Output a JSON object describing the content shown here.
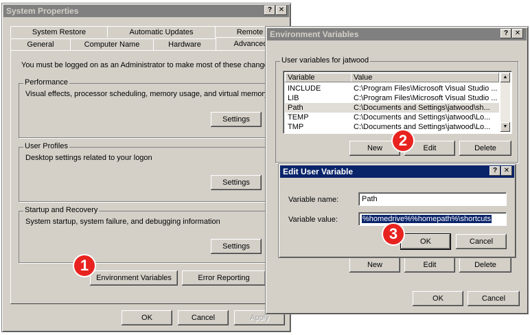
{
  "system_properties": {
    "title": "System Properties",
    "tabs_row1": [
      "System Restore",
      "Automatic Updates",
      "Remote"
    ],
    "tabs_row2": [
      "General",
      "Computer Name",
      "Hardware",
      "Advanced"
    ],
    "admin_notice": "You must be logged on as an Administrator to make most of these changes.",
    "performance": {
      "label": "Performance",
      "desc": "Visual effects, processor scheduling, memory usage, and virtual memory",
      "button": "Settings"
    },
    "user_profiles": {
      "label": "User Profiles",
      "desc": "Desktop settings related to your logon",
      "button": "Settings"
    },
    "startup_recovery": {
      "label": "Startup and Recovery",
      "desc": "System startup, system failure, and debugging information",
      "button": "Settings"
    },
    "env_vars_button": "Environment Variables",
    "error_reporting_button": "Error Reporting",
    "ok": "OK",
    "cancel": "Cancel",
    "apply": "Apply"
  },
  "env_vars": {
    "title": "Environment Variables",
    "user_group_label": "User variables for jatwood",
    "columns": [
      "Variable",
      "Value"
    ],
    "rows": [
      {
        "variable": "INCLUDE",
        "value": "C:\\Program Files\\Microsoft Visual Studio ..."
      },
      {
        "variable": "LIB",
        "value": "C:\\Program Files\\Microsoft Visual Studio ..."
      },
      {
        "variable": "Path",
        "value": "C:\\Documents and Settings\\jatwood\\sh..."
      },
      {
        "variable": "TEMP",
        "value": "C:\\Documents and Settings\\jatwood\\Lo..."
      },
      {
        "variable": "TMP",
        "value": "C:\\Documents and Settings\\jatwood\\Lo..."
      }
    ],
    "new": "New",
    "edit": "Edit",
    "delete": "Delete",
    "ok": "OK",
    "cancel": "Cancel"
  },
  "edit_var": {
    "title": "Edit User Variable",
    "name_label": "Variable name:",
    "name_value": "Path",
    "value_label": "Variable value:",
    "value_value": "%homedrive%%homepath%\\shortcuts",
    "ok": "OK",
    "cancel": "Cancel"
  },
  "badges": [
    "1",
    "2",
    "3"
  ],
  "colors": {
    "active_title": "#0a246a",
    "inactive_title": "#808080",
    "badge": "#e8231f",
    "face": "#d4d0c8"
  }
}
